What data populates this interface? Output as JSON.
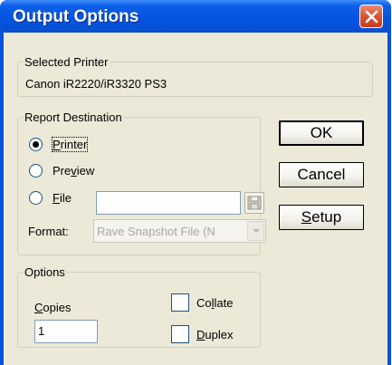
{
  "window": {
    "title": "Output Options"
  },
  "selected_printer": {
    "legend": "Selected Printer",
    "name": "Canon iR2220/iR3320 PS3"
  },
  "destination": {
    "legend": "Report Destination",
    "options": [
      {
        "label_key": "P",
        "label_rest": "rinter",
        "selected": true
      },
      {
        "label_pre": "Pre",
        "label_key": "v",
        "label_rest": "iew",
        "selected": false
      },
      {
        "label_key": "F",
        "label_rest": "ile",
        "selected": false
      }
    ],
    "file_path": "",
    "format_label": "Format:",
    "format_value": "Rave Snapshot File (N"
  },
  "buttons": {
    "ok": "OK",
    "cancel": "Cancel",
    "setup_key": "S",
    "setup_rest": "etup"
  },
  "options": {
    "legend": "Options",
    "copies_label_key": "C",
    "copies_label_rest": "opies",
    "copies_value": "1",
    "collate_pre": "Co",
    "collate_key": "l",
    "collate_rest": "late",
    "collate_checked": false,
    "duplex_key": "D",
    "duplex_rest": "uplex",
    "duplex_checked": false
  },
  "colors": {
    "titlebar": "#0453e0",
    "dialog_face": "#ece9d8",
    "close_button": "#d95535"
  }
}
